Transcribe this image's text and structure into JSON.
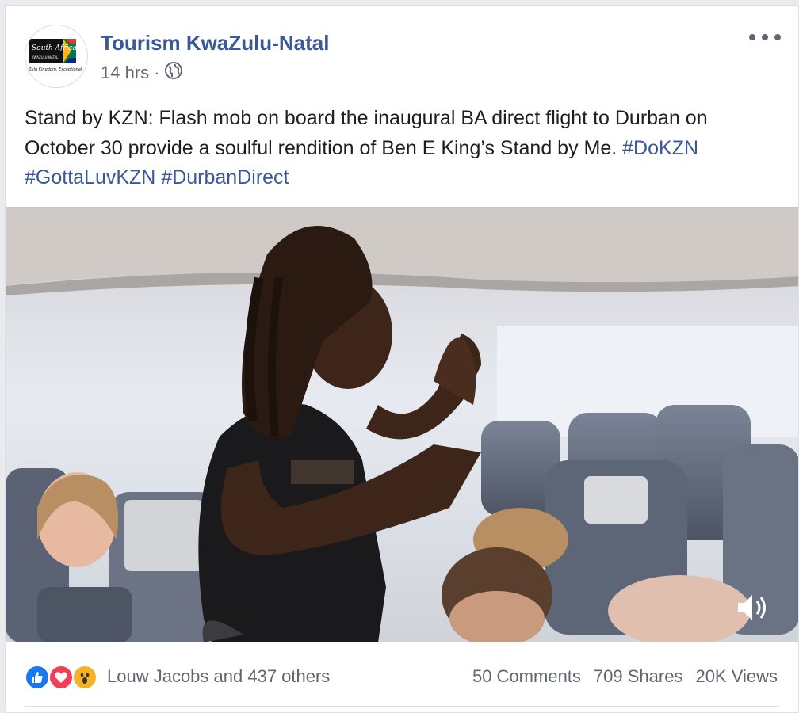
{
  "post": {
    "page_name": "Tourism KwaZulu-Natal",
    "time": "14 hrs",
    "separator": "·",
    "privacy_icon": "globe-icon",
    "more_icon": "more-options-icon",
    "text": "Stand by KZN: Flash mob on board the inaugural BA direct flight to Durban on October 30 provide a soulful rendition of Ben E King’s Stand by Me. ",
    "hashtags": [
      "#DoKZN",
      "#GottaLuvKZN",
      "#DurbanDirect"
    ]
  },
  "avatar": {
    "logo_text": "South Africa",
    "logo_sub": "KWAZULU-NATAL",
    "logo_tagline": "Zulu Kingdom. Exceptional"
  },
  "video": {
    "volume_icon": "volume-icon"
  },
  "reactions": {
    "icons": [
      "like-icon",
      "love-icon",
      "wow-icon"
    ],
    "names": "Louw Jacobs and 437 others"
  },
  "stats": {
    "comments": "50 Comments",
    "shares": "709 Shares",
    "views": "20K Views"
  },
  "colors": {
    "link": "#385898",
    "like": "#1877f2",
    "love": "#f33e58",
    "wow": "#f7b125"
  }
}
